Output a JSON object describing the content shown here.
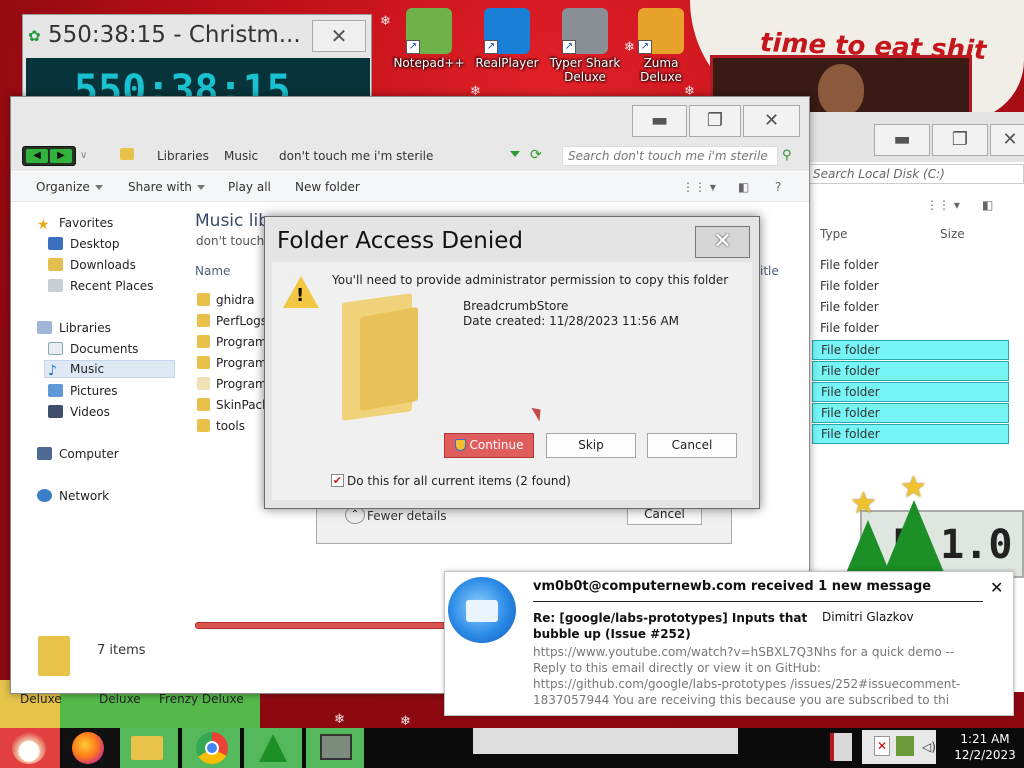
{
  "desktop": {
    "icons": [
      {
        "label": "Notepad++",
        "icon": "notepad-plus-plus-icon"
      },
      {
        "label": "RealPlayer",
        "icon": "realplayer-icon"
      },
      {
        "label": "Typer Shark Deluxe",
        "icon": "typer-shark-icon"
      },
      {
        "label": "Zuma Deluxe",
        "icon": "zuma-icon"
      }
    ],
    "strip_labels": [
      "Deluxe",
      "Deluxe",
      "Frenzy Deluxe"
    ],
    "banner_text": "time to eat shit",
    "gadget_clock": "5 1.0"
  },
  "countdown": {
    "title": "550:38:15 - Christm...",
    "display": "550:38:15"
  },
  "explorer2": {
    "search_placeholder": "Search Local Disk (C:)",
    "columns": [
      "Type",
      "Size"
    ],
    "type_cells": [
      "File folder",
      "File folder",
      "File folder",
      "File folder",
      "File folder",
      "File folder",
      "File folder",
      "File folder",
      "File folder"
    ],
    "selected_from_index": 4
  },
  "explorer": {
    "breadcrumb": [
      "Libraries",
      "Music",
      "don't touch me i'm sterile"
    ],
    "search_placeholder": "Search don't touch me i'm sterile",
    "toolbar": {
      "organize": "Organize",
      "share_with": "Share with",
      "play_all": "Play all",
      "new_folder": "New folder"
    },
    "nav": {
      "favorites": "Favorites",
      "desktop": "Desktop",
      "downloads": "Downloads",
      "recent_places": "Recent Places",
      "libraries": "Libraries",
      "documents": "Documents",
      "music": "Music",
      "pictures": "Pictures",
      "videos": "Videos",
      "computer": "Computer",
      "network": "Network"
    },
    "library_title": "Music lib",
    "library_subtitle": "don't touch n",
    "columns": {
      "name": "Name",
      "title": "itle"
    },
    "files": [
      "ghidra",
      "PerfLogs",
      "Program",
      "Program",
      "Program",
      "SkinPack",
      "tools"
    ],
    "status_items": "7 items",
    "copy_dialog": {
      "fewer_details": "Fewer details",
      "cancel": "Cancel"
    }
  },
  "dialog": {
    "title": "Folder Access Denied",
    "message": "You'll need to provide administrator permission to copy this folder",
    "item_name": "BreadcrumbStore",
    "item_date": "Date created: 11/28/2023 11:56 AM",
    "continue": "Continue",
    "skip": "Skip",
    "cancel": "Cancel",
    "checkbox_label": "Do this for all current items (2 found)",
    "checkbox_checked": true
  },
  "notification": {
    "title": "vm0b0t@computernewb.com received 1 new message",
    "subject": "Re: [google/labs-prototypes] Inputs that bubble up (Issue #252)",
    "author": "Dimitri Glazkov",
    "body": "https://www.youtube.com/watch?v=hSBXL7Q3Nhs for a quick demo -- Reply to this email directly or view it on GitHub: https://github.com/google/labs-prototypes /issues/252#issuecomment-1837057944 You are receiving this because you are subscribed to thi"
  },
  "taskbar": {
    "apps": [
      "start-santa",
      "firefox",
      "windows-explorer",
      "google-chrome",
      "christmas-tree",
      "console"
    ],
    "time": "1:21 AM",
    "date": "12/2/2023"
  },
  "colors": {
    "desktop_red": "#c5101a",
    "selection_cyan": "#76f4f6",
    "continue_red": "#e05d5d",
    "notification_blue": "#2a8ae6"
  }
}
